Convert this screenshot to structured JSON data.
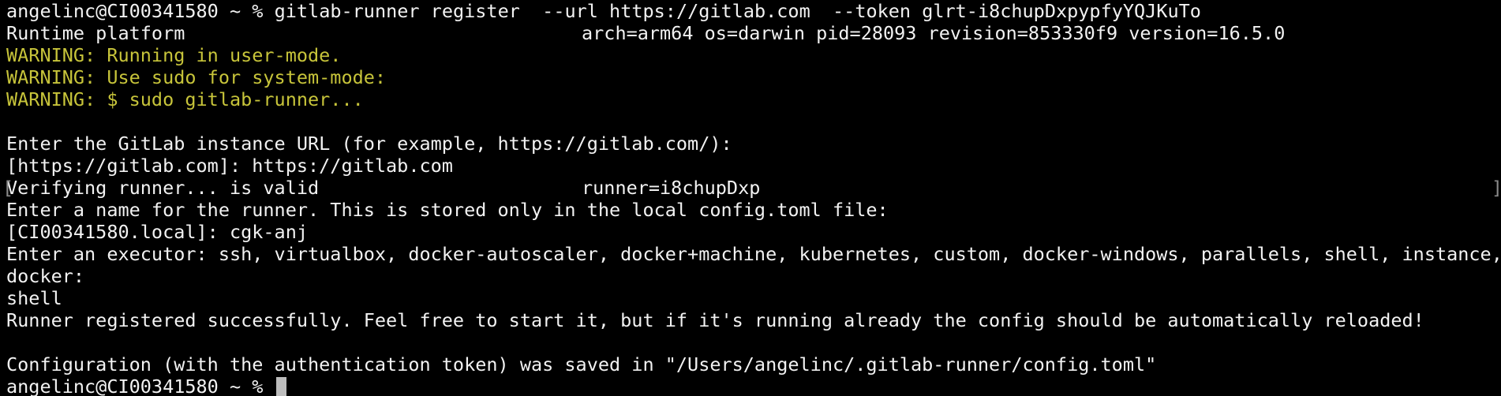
{
  "terminal": {
    "prompt_user_host": "angelinc@CI00341580",
    "prompt_path": "~",
    "prompt_symbol": "%",
    "lines": {
      "cmd": "gitlab-runner register  --url https://gitlab.com  --token glrt-i8chupDxpypfyYQJKuTo",
      "runtime_left": "Runtime platform",
      "runtime_right": "arch=arm64 os=darwin pid=28093 revision=853330f9 version=16.5.0",
      "warn1": "WARNING: Running in user-mode.",
      "warn2": "WARNING: Use sudo for system-mode:",
      "warn3": "WARNING: $ sudo gitlab-runner...",
      "enter_url": "Enter the GitLab instance URL (for example, https://gitlab.com/):",
      "url_answer": "[https://gitlab.com]: https://gitlab.com",
      "verify_left": "Verifying runner... is valid",
      "verify_right": "runner=i8chupDxp",
      "edge_left": "[",
      "edge_right": "]",
      "enter_name": "Enter a name for the runner. This is stored only in the local config.toml file:",
      "name_answer": "[CI00341580.local]: cgk-anj",
      "enter_executor": "Enter an executor: ssh, virtualbox, docker-autoscaler, docker+machine, kubernetes, custom, docker-windows, parallels, shell, instance,",
      "executor_cont": "docker:",
      "executor_answer": "shell",
      "success": "Runner registered successfully. Feel free to start it, but if it's running already the config should be automatically reloaded!",
      "config_saved": "Configuration (with the authentication token) was saved in \"/Users/angelinc/.gitlab-runner/config.toml\""
    },
    "colors": {
      "background": "#000000",
      "foreground": "#f2f2f2",
      "warning": "#c7c43a",
      "cursor": "#bdbdbd"
    }
  }
}
